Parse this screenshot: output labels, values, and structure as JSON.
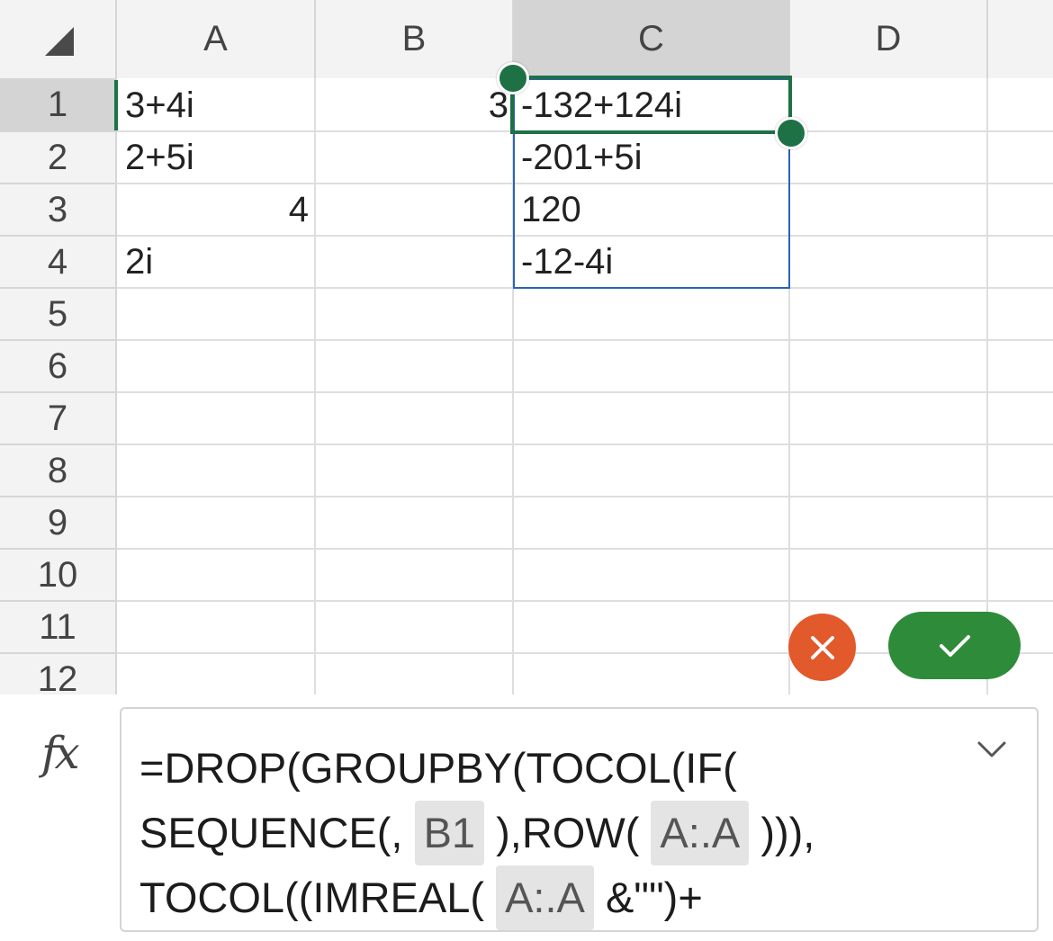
{
  "columns": [
    "A",
    "B",
    "C",
    "D"
  ],
  "rows": [
    "1",
    "2",
    "3",
    "4",
    "5",
    "6",
    "7",
    "8",
    "9",
    "10",
    "11",
    "12"
  ],
  "cells": {
    "A1": "3+4i",
    "A2": "2+5i",
    "A3": "4",
    "A4": "2i",
    "B1": "3",
    "C1": "-132+124i",
    "C2": "-201+5i",
    "C3": "120",
    "C4": "-12-4i"
  },
  "formula": {
    "fx_label": "fx",
    "line1": "=DROP(GROUPBY(TOCOL(IF(",
    "line2_pre": "SEQUENCE(,",
    "line2_ref1": "B1",
    "line2_mid": "),ROW(",
    "line2_ref2": "A:.A",
    "line2_post": "))),",
    "line3_pre": "TOCOL((IMREAL(",
    "line3_ref": "A:.A",
    "line3_post": "&\"\")+"
  },
  "icons": {
    "cancel": "close-icon",
    "confirm": "checkmark-icon",
    "expand": "chevron-down-icon"
  },
  "colors": {
    "active_border": "#1e7145",
    "spill_border": "#2a62b8",
    "cancel_button": "#e2592c",
    "confirm_button": "#2e8b3a"
  }
}
